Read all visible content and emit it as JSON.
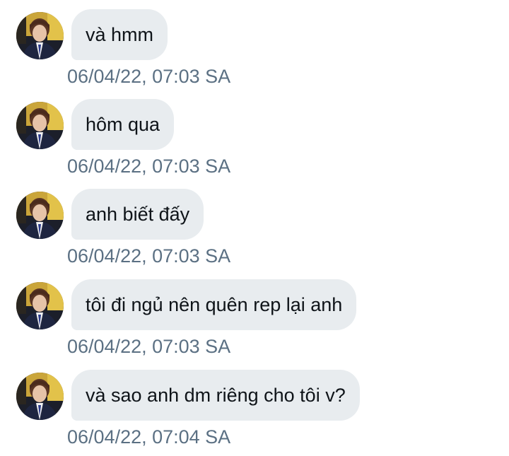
{
  "messages": [
    {
      "text": "và hmm",
      "time": "06/04/22, 07:03 SA"
    },
    {
      "text": "hôm qua",
      "time": "06/04/22, 07:03 SA"
    },
    {
      "text": "anh biết đấy",
      "time": "06/04/22, 07:03 SA"
    },
    {
      "text": "tôi đi ngủ nên quên rep lại anh",
      "time": "06/04/22, 07:03 SA"
    },
    {
      "text": "và sao anh dm riêng cho tôi v?",
      "time": "06/04/22, 07:04 SA"
    }
  ]
}
